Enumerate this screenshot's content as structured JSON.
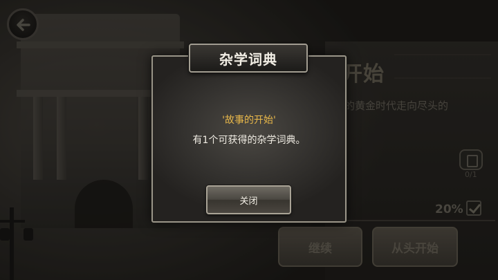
{
  "background": {
    "title": "开始",
    "description": "的黄金时代走向尽头的",
    "collection_count": "0/1",
    "progress": "20%",
    "progress_complete": true,
    "continue_label": "继续",
    "restart_label": "从头开始"
  },
  "dialog": {
    "title": "杂学词典",
    "story_name": "'故事的开始'",
    "message": "有1个可获得的杂学词典。",
    "close_label": "关闭"
  },
  "colors": {
    "story_highlight": "#e9b84a",
    "dialog_text": "#f0ece3"
  },
  "icons": {
    "back": "back-arrow-icon",
    "collection": "book-icon",
    "progress": "checkbox-checked-icon"
  }
}
